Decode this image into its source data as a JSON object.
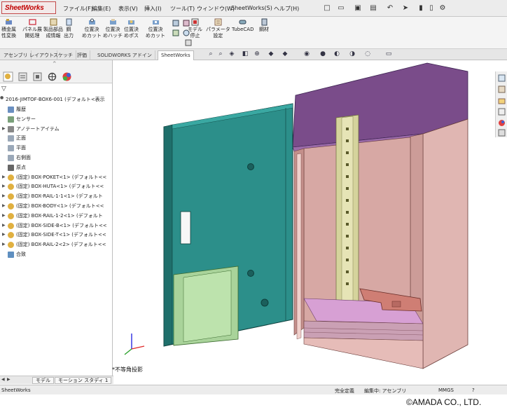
{
  "app": {
    "logo_text": "SheetWorks"
  },
  "menubar": {
    "items": [
      "ファイル(F)",
      "編集(E)",
      "表示(V)",
      "挿入(I)",
      "ツール(T)",
      "ウィンドウ(W)",
      "SheetWorks(S)",
      "ヘルプ(H)"
    ]
  },
  "command_manager": {
    "buttons": [
      {
        "label1": "積金属",
        "label2": "性変換"
      },
      {
        "label1": "パネル展",
        "label2": "開処理"
      },
      {
        "label1": "製品部品",
        "label2": "成情報"
      },
      {
        "label1": "鋼",
        "label2": "出力"
      },
      {
        "label1": "位置決",
        "label2": "めカット"
      },
      {
        "label1": "位置決",
        "label2": "めハッチ"
      },
      {
        "label1": "位置決",
        "label2": "めボ゙ス"
      },
      {
        "label1": "位置決",
        "label2": "めカット"
      },
      {
        "label1": "モデル",
        "label2": "停止"
      },
      {
        "label1": "パラメータ",
        "label2": "設定"
      },
      {
        "label1": "TubeCAD",
        "label2": ""
      },
      {
        "label1": "鋼材",
        "label2": ""
      }
    ]
  },
  "tabs": [
    "アセンブリ",
    "レイアウト",
    "スケッチ",
    "評価",
    "SOLIDWORKS アドイン",
    "SheetWorks"
  ],
  "active_tab": "SheetWorks",
  "tree": {
    "root": "2016-JIMTOF-BOX6-001 (デフォルト<表示",
    "items": [
      {
        "label": "履歴",
        "icon": "history-icon",
        "arrow": ""
      },
      {
        "label": "センサー",
        "icon": "sensor-icon",
        "arrow": ""
      },
      {
        "label": "アノテートアイテム",
        "icon": "annotation-icon",
        "arrow": "▶"
      },
      {
        "label": "正面",
        "icon": "plane-icon",
        "arrow": ""
      },
      {
        "label": "平面",
        "icon": "plane-icon",
        "arrow": ""
      },
      {
        "label": "右側面",
        "icon": "plane-icon",
        "arrow": ""
      },
      {
        "label": "原点",
        "icon": "origin-icon",
        "arrow": ""
      },
      {
        "label": "(固定) BOX-POKET<1> (デフォルト<<",
        "icon": "part-icon",
        "arrow": "▶"
      },
      {
        "label": "(固定) BOX-HUTA<1> (デフォルト<<",
        "icon": "part-icon",
        "arrow": "▶"
      },
      {
        "label": "(固定) BOX-RAIL-1-1<1> (デフォルト",
        "icon": "part-icon",
        "arrow": "▶"
      },
      {
        "label": "(固定) BOX-BODY<1> (デフォルト<<",
        "icon": "part-icon",
        "arrow": "▶"
      },
      {
        "label": "(固定) BOX-RAIL-1-2<1> (デフォルト",
        "icon": "part-icon",
        "arrow": "▶"
      },
      {
        "label": "(固定) BOX-SIDE-B<1> (デフォルト<<",
        "icon": "part-icon",
        "arrow": "▶"
      },
      {
        "label": "(固定) BOX-SIDE-T<1> (デフォルト<<",
        "icon": "part-icon",
        "arrow": "▶"
      },
      {
        "label": "(固定) BOX-RAIL-2<2> (デフォルト<<",
        "icon": "part-icon",
        "arrow": "▶"
      },
      {
        "label": "合致",
        "icon": "mate-icon",
        "arrow": ""
      }
    ]
  },
  "viewport": {
    "shading_label": "*不等角投影"
  },
  "bottom_tabs": [
    "モデル",
    "モーション スタディ 1"
  ],
  "status": {
    "app": "SheetWorks",
    "state": "完全定義",
    "mode": "編集中: アセンブリ",
    "units": "MMGS"
  },
  "copyright": "©AMADA CO., LTD.",
  "colors": {
    "accent": "#c00000",
    "door": "#2f8f8a",
    "roof": "#7a4c8a",
    "body": "#d8a8a8",
    "rail": "#d4d0a0",
    "pocket": "#a9d39a",
    "bracket": "#cf7e74"
  }
}
